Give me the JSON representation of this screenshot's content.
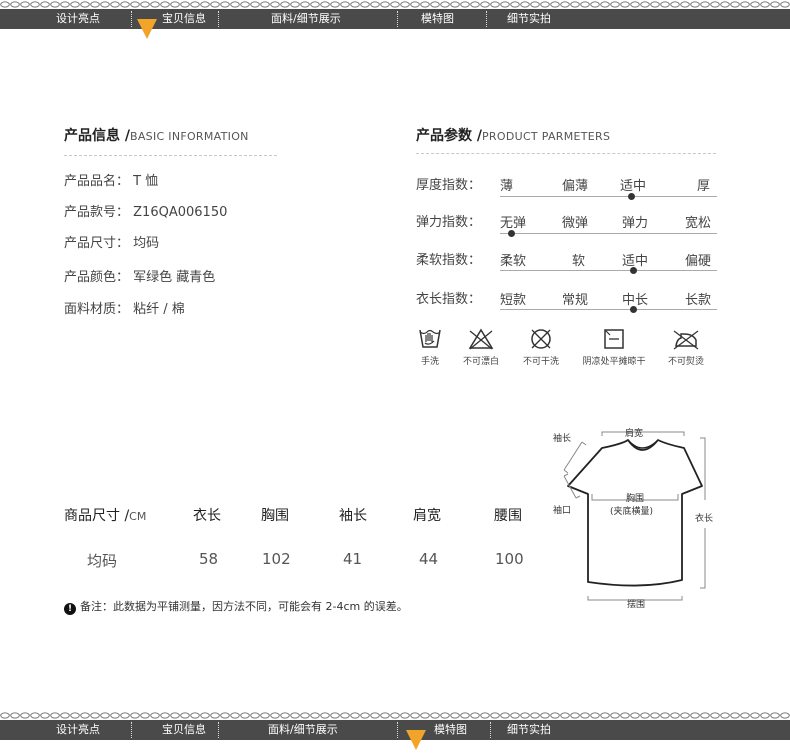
{
  "nav": {
    "items": [
      "设计亮点",
      "宝贝信息",
      "面料/细节展示",
      "模特图",
      "细节实拍"
    ],
    "top_active": "宝贝信息",
    "bottom_active": "模特图"
  },
  "basic": {
    "title": "产品信息 /",
    "subtitle": "BASIC INFORMATION",
    "rows": [
      {
        "label": "产品品名：",
        "value": "T 恤"
      },
      {
        "label": "产品款号：",
        "value": "Z16QA006150"
      },
      {
        "label": "产品尺寸：",
        "value": "均码"
      },
      {
        "label": "产品颜色：",
        "value": "军绿色 藏青色"
      },
      {
        "label": "面料材质：",
        "value": "粘纤 / 棉"
      }
    ]
  },
  "params": {
    "title": "产品参数 /",
    "subtitle": "PRODUCT PARMETERS",
    "rows": [
      {
        "label": "厚度指数：",
        "options": [
          "薄",
          "偏薄",
          "适中",
          "厚"
        ],
        "selected_index": 2
      },
      {
        "label": "弹力指数：",
        "options": [
          "无弹",
          "微弹",
          "弹力",
          "宽松"
        ],
        "selected_index": 0
      },
      {
        "label": "柔软指数：",
        "options": [
          "柔软",
          "软",
          "适中",
          "偏硬"
        ],
        "selected_index": 2
      },
      {
        "label": "衣长指数：",
        "options": [
          "短款",
          "常规",
          "中长",
          "长款"
        ],
        "selected_index": 2
      }
    ]
  },
  "care": [
    {
      "icon": "hand-wash-icon",
      "label": "手洗"
    },
    {
      "icon": "no-bleach-icon",
      "label": "不可漂白"
    },
    {
      "icon": "no-dry-clean-icon",
      "label": "不可干洗"
    },
    {
      "icon": "flat-dry-shade-icon",
      "label": "阴凉处平摊晾干"
    },
    {
      "icon": "no-iron-icon",
      "label": "不可熨烫"
    }
  ],
  "size_table": {
    "header_label": "商品尺寸 /",
    "header_unit": "CM",
    "columns": [
      "衣长",
      "胸围",
      "袖长",
      "肩宽",
      "腰围"
    ],
    "row_label": "均码",
    "values": [
      "58",
      "102",
      "41",
      "44",
      "100"
    ]
  },
  "note": {
    "icon_glyph": "!",
    "text": "备注：此数据为平铺测量，因方法不同，可能会有 2-4cm 的误差。"
  },
  "diagram": {
    "sleeve_length": "袖长",
    "shoulder_width": "肩宽",
    "cuff": "袖口",
    "chest": "胸围",
    "chest_note": "(夹底横量)",
    "length": "衣长",
    "hem": "摆围"
  }
}
